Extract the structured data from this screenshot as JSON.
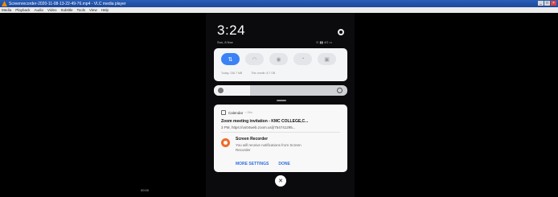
{
  "window": {
    "title": "Screenrecorder-2020-11-08-13-22-49-76.mp4 - VLC media player",
    "controls": [
      "_",
      "□",
      "×"
    ]
  },
  "menubar": [
    "Media",
    "Playback",
    "Audio",
    "Video",
    "Subtitle",
    "Tools",
    "View",
    "Help"
  ],
  "phone": {
    "clock": "3:24",
    "date": "Sun, 8 Nov",
    "status": "⊙ ▮▮ 4G ▭",
    "quick_settings": {
      "tiles": [
        {
          "icon": "data-icon",
          "glyph": "⇅",
          "active": true
        },
        {
          "icon": "wifi-icon",
          "glyph": "◠",
          "active": false
        },
        {
          "icon": "torch-icon",
          "glyph": "◉",
          "active": false
        },
        {
          "icon": "bell-icon",
          "glyph": "◔",
          "active": false
        },
        {
          "icon": "screen-icon",
          "glyph": "▣",
          "active": false
        }
      ],
      "data_today": "Today: 236.7 MB",
      "data_month": "This month: 8.7 GB"
    },
    "brightness_level": 0.27,
    "calendar_notification": {
      "app": "Calendar",
      "time": "• 15m",
      "title": "Zoom meeting invitation - KMC COLLEGE,C...",
      "body": "3 PM, https://us04web.zoom.us/j/754741295..."
    },
    "recorder_notification": {
      "title": "Screen Recorder",
      "body": "You will receive notifications from Screen Recorder"
    },
    "actions": {
      "more": "MORE SETTINGS",
      "done": "DONE"
    },
    "clear_glyph": "✕"
  },
  "stamp": "00:00"
}
